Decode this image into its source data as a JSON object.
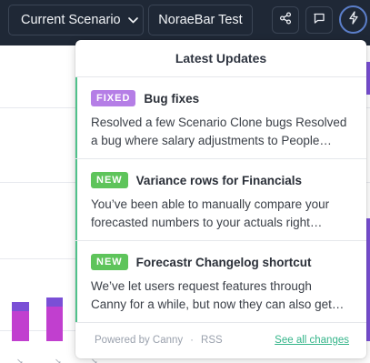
{
  "topbar": {
    "scenario_label": "Current Scenario",
    "company_label": "NoraeBar Test",
    "icons": [
      "share-icon",
      "chat-icon",
      "lightning-icon",
      "chevron-down-icon"
    ],
    "background_color": "#1f2836"
  },
  "popover": {
    "title": "Latest Updates",
    "entries": [
      {
        "badge": "FIXED",
        "badge_color": "#b57ee6",
        "title": "Bug fixes",
        "body_line1": "Resolved a few Scenario Clone bugs Resolved",
        "body_line2": "a bug where salary adjustments to People…"
      },
      {
        "badge": "NEW",
        "badge_color": "#5ec45b",
        "title": "Variance rows for Financials",
        "body_line1": "You’ve been able to manually compare your",
        "body_line2": "forecasted numbers to your actuals right…"
      },
      {
        "badge": "NEW",
        "badge_color": "#5ec45b",
        "title": "Forecastr Changelog shortcut",
        "body_line1": "We’ve let users request features through",
        "body_line2": "Canny for a while, but now they can also get…"
      }
    ],
    "footer": {
      "powered_by": "Powered by Canny",
      "separator": "·",
      "rss": "RSS",
      "see_all": "See all changes"
    }
  },
  "colors": {
    "accent_green": "#35b58a",
    "bar_magenta": "#c13fcf",
    "bar_purple": "#7a4fd6"
  }
}
